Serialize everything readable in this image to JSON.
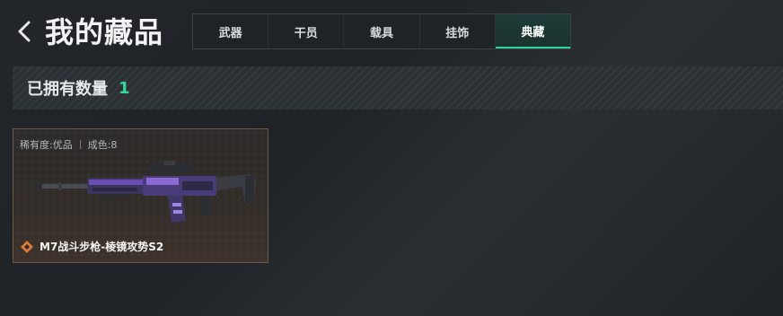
{
  "header": {
    "title": "我的藏品",
    "tabs": [
      {
        "label": "武器",
        "active": false
      },
      {
        "label": "干员",
        "active": false
      },
      {
        "label": "载具",
        "active": false
      },
      {
        "label": "挂饰",
        "active": false
      },
      {
        "label": "典藏",
        "active": true
      }
    ]
  },
  "summary": {
    "owned_label": "已拥有数量",
    "owned_count": "1"
  },
  "items": [
    {
      "rarity": "稀有度:优品",
      "condition": "成色:8",
      "name": "M7战斗步枪-棱镜攻势S2",
      "rarity_icon": "diamond-rarity-icon"
    }
  ],
  "colors": {
    "accent": "#36d99c",
    "card_border": "#6b5a4a",
    "rarity_icon": "#d9793a",
    "weapon_purple": "#6a4fb0"
  }
}
